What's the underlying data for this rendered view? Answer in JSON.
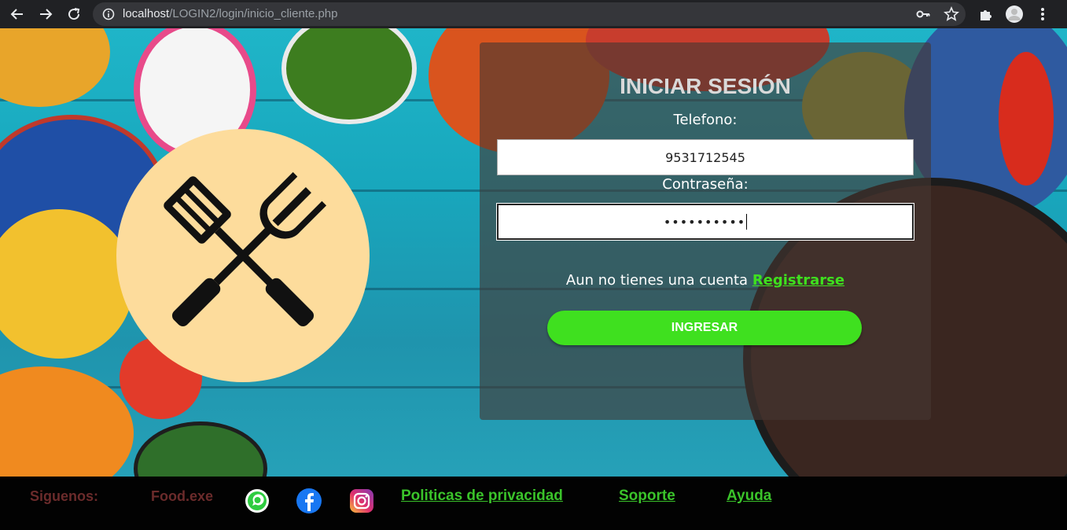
{
  "browser": {
    "url_host": "localhost",
    "url_path": "/LOGIN2/login/inicio_cliente.php",
    "icons": [
      "back-icon",
      "forward-icon",
      "reload-icon",
      "info-icon",
      "key-icon",
      "star-icon",
      "extensions-icon",
      "profile-icon",
      "menu-icon"
    ]
  },
  "login": {
    "title": "INICIAR SESIÓN",
    "phone_label": "Telefono:",
    "phone_value": "9531712545",
    "password_label": "Contraseña:",
    "password_value": "••••••••••",
    "register_prompt": "Aun no tienes una cuenta",
    "register_link": "Registrarse",
    "submit_label": "INGRESAR",
    "accent_color": "#3fe01f"
  },
  "logo": {
    "icon": "spatula-fork-icon",
    "background": "#fddc9c"
  },
  "footer": {
    "follow_label": "Siguenos:",
    "brand": "Food.exe",
    "social": [
      "whatsapp-icon",
      "facebook-icon",
      "instagram-icon"
    ],
    "links": [
      "Politicas de privacidad",
      "Soporte",
      "Ayuda"
    ]
  }
}
